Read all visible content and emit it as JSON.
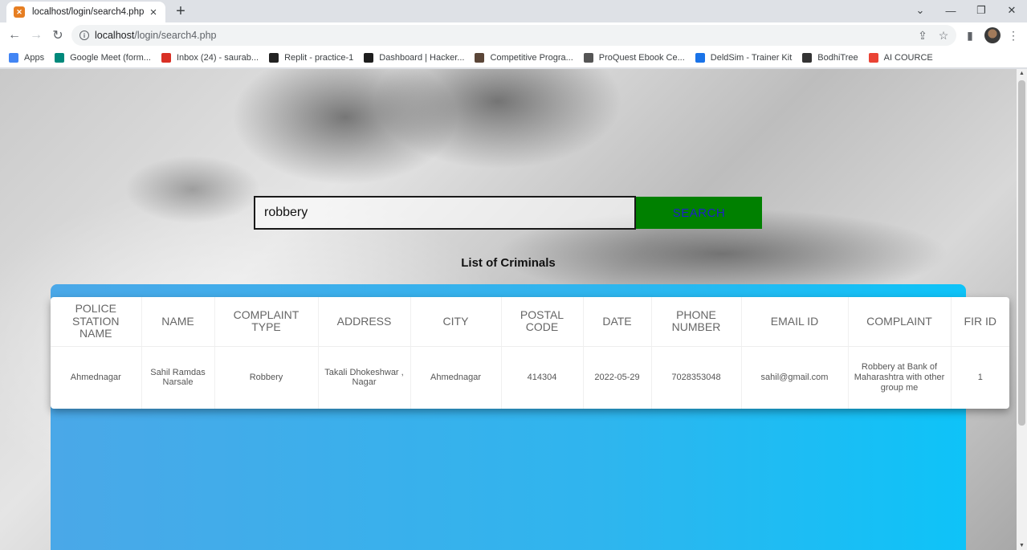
{
  "browser": {
    "tab_title": "localhost/login/search4.php",
    "url_host": "localhost",
    "url_path": "/login/search4.php",
    "bookmarks": [
      {
        "label": "Apps",
        "icon": "apps-grid-icon",
        "color": "#4285f4"
      },
      {
        "label": "Google Meet (form...",
        "icon": "google-meet-icon",
        "color": "#00897b"
      },
      {
        "label": "Inbox (24) - saurab...",
        "icon": "gmail-icon",
        "color": "#d93025"
      },
      {
        "label": "Replit - practice-1",
        "icon": "replit-icon",
        "color": "#222222"
      },
      {
        "label": "Dashboard | Hacker...",
        "icon": "hackerearth-icon",
        "color": "#1e1e1e"
      },
      {
        "label": "Competitive Progra...",
        "icon": "codechef-icon",
        "color": "#5b4638"
      },
      {
        "label": "ProQuest Ebook Ce...",
        "icon": "proquest-icon",
        "color": "#555555"
      },
      {
        "label": "DeldSim - Trainer Kit",
        "icon": "deldsim-icon",
        "color": "#1a73e8"
      },
      {
        "label": "BodhiTree",
        "icon": "graduation-cap-icon",
        "color": "#333333"
      },
      {
        "label": "AI COURCE",
        "icon": "google-icon",
        "color": "#ea4335"
      }
    ]
  },
  "search": {
    "value": "robbery",
    "button_label": "SEARCH"
  },
  "list_title": "List of Criminals",
  "table": {
    "headers": [
      "POLICE STATION NAME",
      "NAME",
      "COMPLAINT TYPE",
      "ADDRESS",
      "CITY",
      "POSTAL CODE",
      "DATE",
      "PHONE NUMBER",
      "EMAIL ID",
      "COMPLAINT",
      "FIR ID"
    ],
    "rows": [
      [
        "Ahmednagar",
        "Sahil Ramdas Narsale",
        "Robbery",
        "Takali Dhokeshwar , Nagar",
        "Ahmednagar",
        "414304",
        "2022-05-29",
        "7028353048",
        "sahil@gmail.com",
        "Robbery at Bank of Maharashtra with other group me",
        "1"
      ]
    ]
  }
}
